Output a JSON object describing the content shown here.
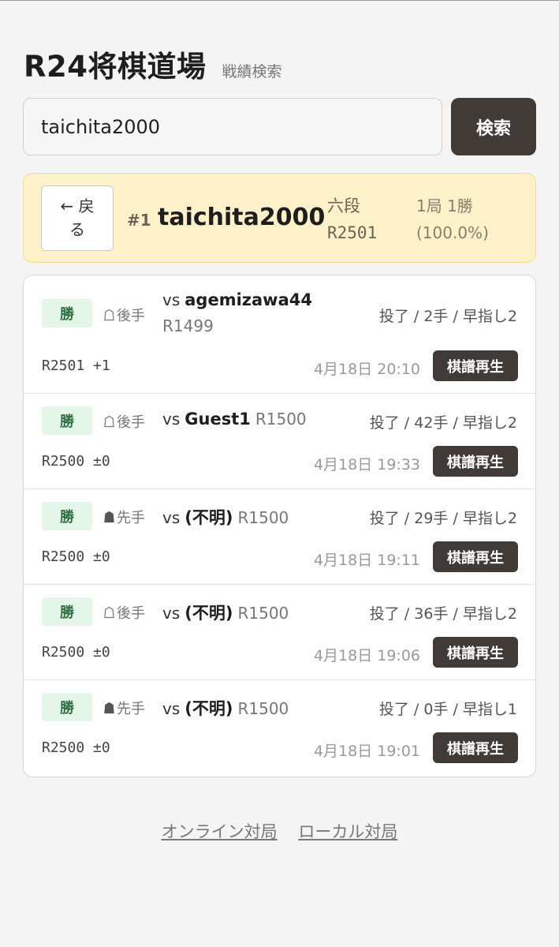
{
  "header": {
    "title": "R24将棋道場",
    "subtitle": "戦績検索"
  },
  "search": {
    "value": "taichita2000",
    "button_label": "検索"
  },
  "player": {
    "back_label_line1": "← 戻",
    "back_label_line2": "る",
    "rank": "#1",
    "name": "taichita2000",
    "grade": "六段",
    "rating": "R2501",
    "record": "1局 1勝",
    "win_rate": "(100.0%)"
  },
  "games": [
    {
      "result": "勝",
      "side": "後手",
      "side_type": "gote",
      "vs": "vs",
      "opponent": "agemizawa44",
      "opponent_rating": "R1499",
      "info": "投了 / 2手 / 早指し2",
      "rating_change": "R2501 +1",
      "date": "4月18日 20:10",
      "replay_label": "棋譜再生"
    },
    {
      "result": "勝",
      "side": "後手",
      "side_type": "gote",
      "vs": "vs",
      "opponent": "Guest1",
      "opponent_rating": "R1500",
      "info": "投了 / 42手 / 早指し2",
      "rating_change": "R2500 ±0",
      "date": "4月18日 19:33",
      "replay_label": "棋譜再生"
    },
    {
      "result": "勝",
      "side": "先手",
      "side_type": "sente",
      "vs": "vs",
      "opponent": "(不明)",
      "opponent_rating": "R1500",
      "info": "投了 / 29手 / 早指し2",
      "rating_change": "R2500 ±0",
      "date": "4月18日 19:11",
      "replay_label": "棋譜再生"
    },
    {
      "result": "勝",
      "side": "後手",
      "side_type": "gote",
      "vs": "vs",
      "opponent": "(不明)",
      "opponent_rating": "R1500",
      "info": "投了 / 36手 / 早指し2",
      "rating_change": "R2500 ±0",
      "date": "4月18日 19:06",
      "replay_label": "棋譜再生"
    },
    {
      "result": "勝",
      "side": "先手",
      "side_type": "sente",
      "vs": "vs",
      "opponent": "(不明)",
      "opponent_rating": "R1500",
      "info": "投了 / 0手 / 早指し1",
      "rating_change": "R2500 ±0",
      "date": "4月18日 19:01",
      "replay_label": "棋譜再生"
    }
  ],
  "footer": {
    "online_label": "オンライン対局",
    "local_label": "ローカル対局"
  },
  "colors": {
    "accent_dark": "#403b37",
    "player_card_bg": "#fcf1c9",
    "win_badge_bg": "#e4f6e8",
    "win_badge_text": "#2e6e40"
  }
}
